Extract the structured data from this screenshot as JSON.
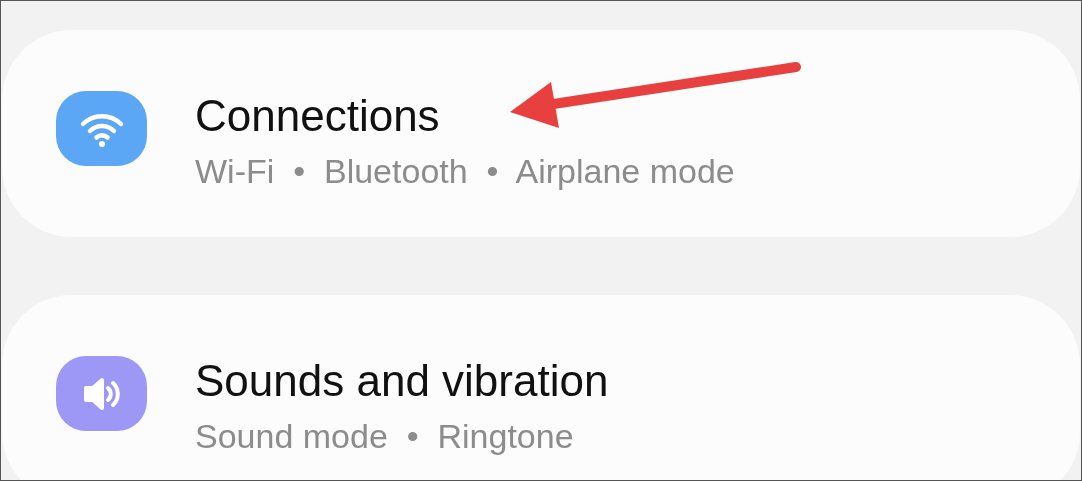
{
  "settings_items": [
    {
      "kind": "connections",
      "title": "Connections",
      "subtitle": "Wi-Fi  •  Bluetooth  •  Airplane mode",
      "highlighted": true
    },
    {
      "kind": "sounds",
      "title": "Sounds and vibration",
      "subtitle": "Sound mode  •  Ringtone",
      "highlighted": false
    }
  ]
}
